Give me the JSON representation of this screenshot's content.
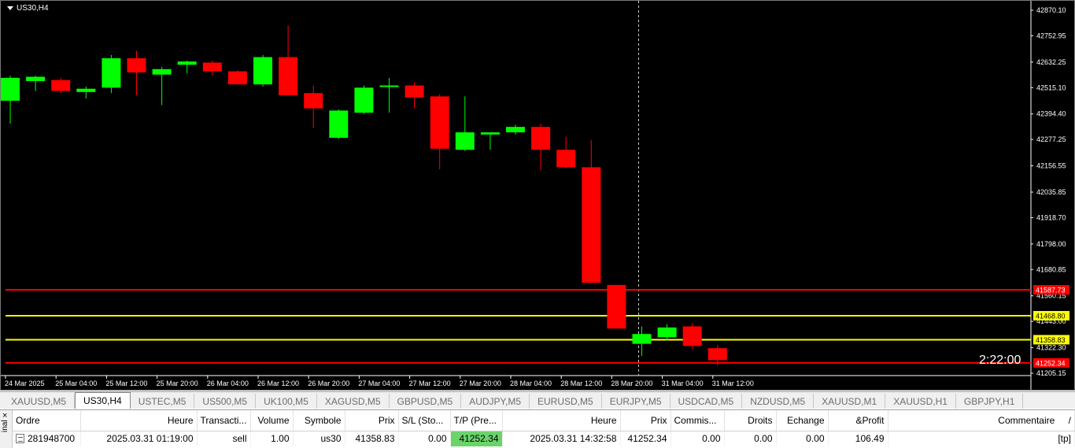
{
  "chart": {
    "title": "US30,H4",
    "countdown": "2:22:00",
    "colors": {
      "up": "#00ff00",
      "down": "#ff0000",
      "background": "#000000",
      "axis": "#ffffff",
      "sl_line": "#ff0000",
      "entry_line": "#ffff00"
    },
    "price_ticks": [
      "42870.10",
      "42752.95",
      "42632.25",
      "42515.10",
      "42394.40",
      "42277.25",
      "42156.55",
      "42035.85",
      "41918.70",
      "41798.00",
      "41680.85",
      "41560.15",
      "41443.00",
      "41322.30",
      "41205.15"
    ],
    "time_ticks": [
      "24 Mar 2025",
      "25 Mar 04:00",
      "25 Mar 12:00",
      "25 Mar 20:00",
      "26 Mar 04:00",
      "26 Mar 12:00",
      "26 Mar 20:00",
      "27 Mar 04:00",
      "27 Mar 12:00",
      "27 Mar 20:00",
      "28 Mar 04:00",
      "28 Mar 12:00",
      "28 Mar 20:00",
      "31 Mar 04:00",
      "31 Mar 12:00"
    ],
    "price_labels": [
      {
        "value": 41587.73,
        "text": "41587.73",
        "color": "#ff0000",
        "text_color": "#ffffff"
      },
      {
        "value": 41468.8,
        "text": "41468.80",
        "color": "#ffff00",
        "text_color": "#000000"
      },
      {
        "value": 41358.83,
        "text": "41358.83",
        "color": "#ffff00",
        "text_color": "#000000"
      },
      {
        "value": 41252.34,
        "text": "41252.34",
        "color": "#ff0000",
        "text_color": "#ffffff"
      }
    ],
    "candles": [
      {
        "o": 42455,
        "h": 42570,
        "l": 42350,
        "c": 42560
      },
      {
        "o": 42545,
        "h": 42570,
        "l": 42500,
        "c": 42565
      },
      {
        "o": 42550,
        "h": 42560,
        "l": 42490,
        "c": 42500
      },
      {
        "o": 42495,
        "h": 42520,
        "l": 42465,
        "c": 42510
      },
      {
        "o": 42515,
        "h": 42665,
        "l": 42490,
        "c": 42650
      },
      {
        "o": 42650,
        "h": 42685,
        "l": 42480,
        "c": 42585
      },
      {
        "o": 42575,
        "h": 42610,
        "l": 42435,
        "c": 42600
      },
      {
        "o": 42620,
        "h": 42640,
        "l": 42580,
        "c": 42635
      },
      {
        "o": 42630,
        "h": 42640,
        "l": 42570,
        "c": 42590
      },
      {
        "o": 42590,
        "h": 42595,
        "l": 42535,
        "c": 42530
      },
      {
        "o": 42530,
        "h": 42665,
        "l": 42520,
        "c": 42655
      },
      {
        "o": 42655,
        "h": 42800,
        "l": 42480,
        "c": 42480
      },
      {
        "o": 42490,
        "h": 42525,
        "l": 42330,
        "c": 42420
      },
      {
        "o": 42285,
        "h": 42415,
        "l": 42280,
        "c": 42410
      },
      {
        "o": 42400,
        "h": 42525,
        "l": 42395,
        "c": 42515
      },
      {
        "o": 42520,
        "h": 42560,
        "l": 42400,
        "c": 42525
      },
      {
        "o": 42525,
        "h": 42540,
        "l": 42420,
        "c": 42470
      },
      {
        "o": 42475,
        "h": 42485,
        "l": 42140,
        "c": 42235
      },
      {
        "o": 42230,
        "h": 42475,
        "l": 42225,
        "c": 42310
      },
      {
        "o": 42300,
        "h": 42310,
        "l": 42230,
        "c": 42310
      },
      {
        "o": 42310,
        "h": 42345,
        "l": 42300,
        "c": 42335
      },
      {
        "o": 42335,
        "h": 42350,
        "l": 42135,
        "c": 42230
      },
      {
        "o": 42230,
        "h": 42290,
        "l": 42145,
        "c": 42150
      },
      {
        "o": 42150,
        "h": 42275,
        "l": 41620,
        "c": 41620
      },
      {
        "o": 41610,
        "h": 41610,
        "l": 41410,
        "c": 41410
      },
      {
        "o": 41340,
        "h": 41420,
        "l": 41285,
        "c": 41385
      },
      {
        "o": 41370,
        "h": 41430,
        "l": 41355,
        "c": 41415
      },
      {
        "o": 41420,
        "h": 41435,
        "l": 41315,
        "c": 41330
      },
      {
        "o": 41320,
        "h": 41335,
        "l": 41240,
        "c": 41265
      }
    ]
  },
  "tabs": [
    "XAUUSD,M5",
    "US30,H4",
    "USTEC,M5",
    "US500,M5",
    "UK100,M5",
    "XAGUSD,M5",
    "GBPUSD,M5",
    "AUDJPY,M5",
    "EURUSD,M5",
    "EURJPY,M5",
    "USDCAD,M5",
    "NZDUSD,M5",
    "XAUUSD,M1",
    "XAUUSD,H1",
    "GBPJPY,H1"
  ],
  "active_tab": "US30,H4",
  "terminal": {
    "side_label": "inal",
    "close_glyph": "×",
    "columns": [
      "Ordre",
      "Heure",
      "Transacti...",
      "Volume",
      "Symbole",
      "Prix",
      "S/L (Sto...",
      "T/P (Pre...",
      "Heure",
      "Prix",
      "Commis...",
      "Droits",
      "Echange",
      "&Profit",
      "Commentaire"
    ],
    "sort_indicator": "/",
    "row": {
      "ordre": "281948700",
      "heure": "2025.03.31 01:19:00",
      "transaction": "sell",
      "volume": "1.00",
      "symbole": "us30",
      "prix": "41358.83",
      "sl": "0.00",
      "tp": "41252.34",
      "heure2": "2025.03.31 14:32:58",
      "prix2": "41252.34",
      "commission": "0.00",
      "droits": "0.00",
      "echange": "0.00",
      "profit": "106.49",
      "commentaire": "[tp]"
    }
  }
}
